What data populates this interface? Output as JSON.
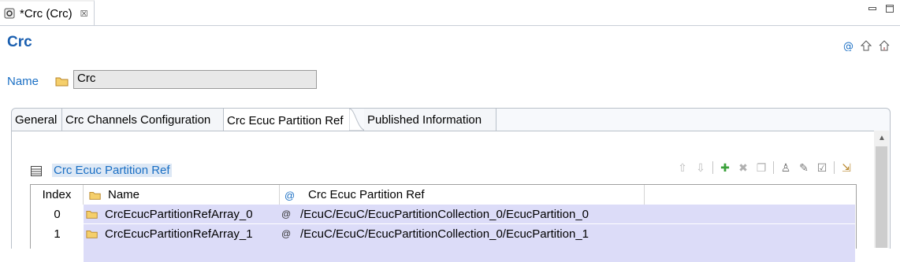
{
  "editor_tab": {
    "label": "*Crc (Crc)",
    "close": "☒"
  },
  "page_title": "Crc",
  "name_field": {
    "label": "Name",
    "value": "Crc"
  },
  "section_tabs": [
    {
      "label": "General"
    },
    {
      "label": "Crc Channels Configuration"
    },
    {
      "label": "Crc Ecuc Partition Ref"
    },
    {
      "label": "Published Information"
    }
  ],
  "table_section": {
    "title": "Crc Ecuc Partition Ref"
  },
  "table": {
    "columns": {
      "index": "Index",
      "name": "Name",
      "ref": "Crc Ecuc Partition Ref"
    },
    "rows": [
      {
        "index": "0",
        "name": "CrcEcucPartitionRefArray_0",
        "ref": "/EcuC/EcuC/EcucPartitionCollection_0/EcucPartition_0"
      },
      {
        "index": "1",
        "name": "CrcEcucPartitionRefArray_1",
        "ref": "/EcuC/EcuC/EcucPartitionCollection_0/EcucPartition_1"
      }
    ]
  },
  "colors": {
    "accent": "#1a6fc4",
    "selected_row": "#dcdcf8",
    "title": "#1a5fb0"
  }
}
